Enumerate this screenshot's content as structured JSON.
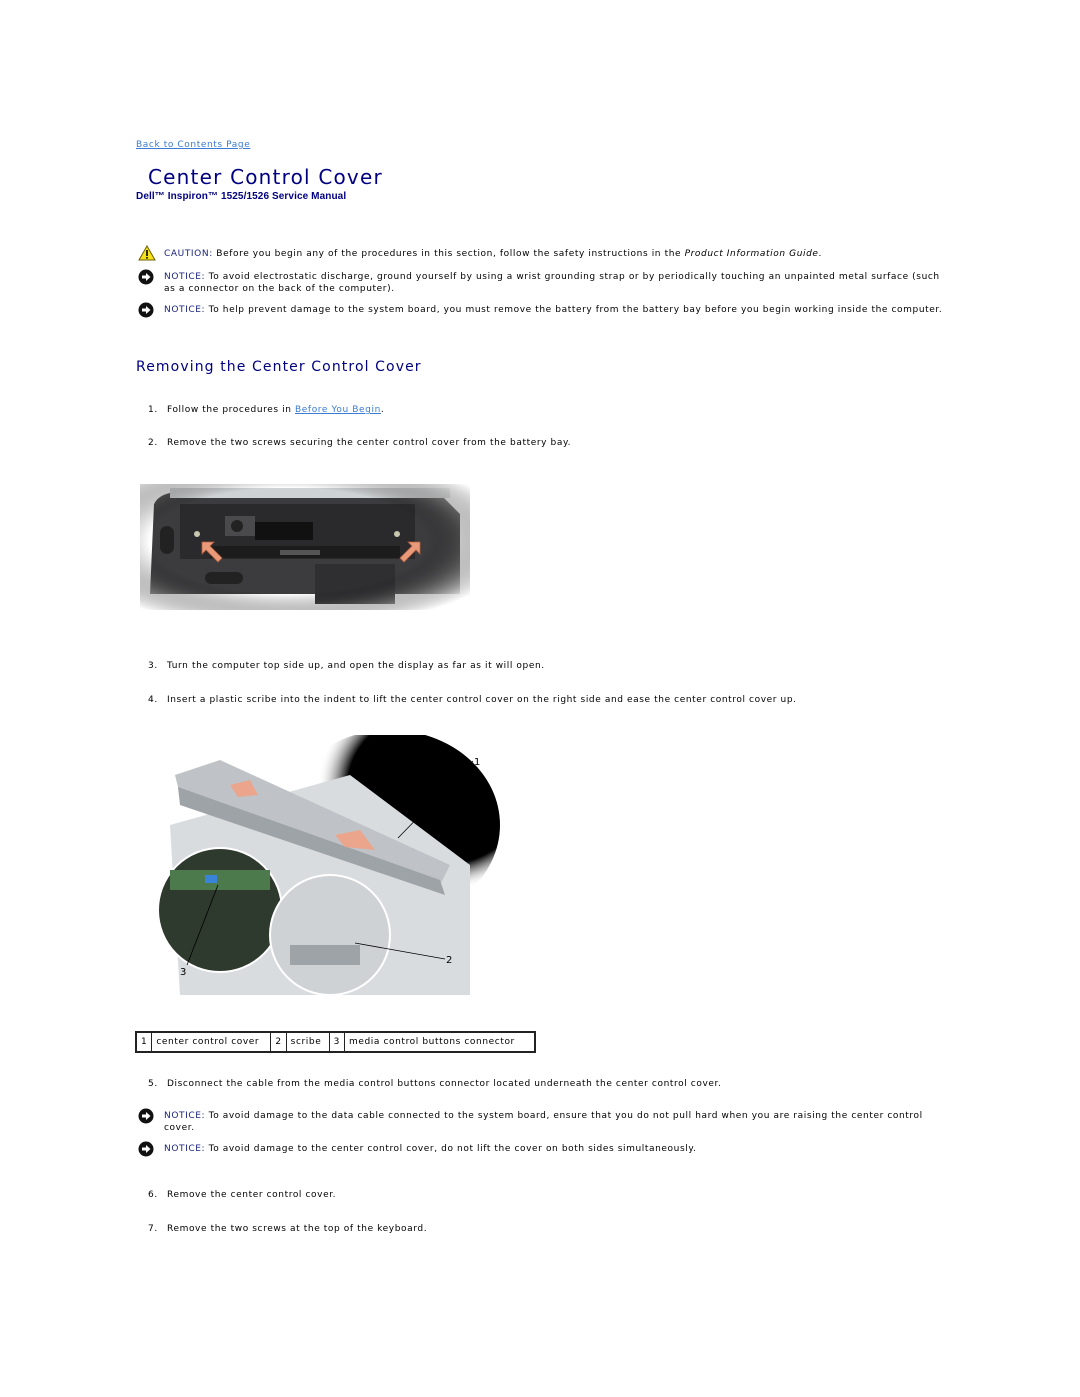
{
  "nav": {
    "back_link": "Back to Contents Page"
  },
  "header": {
    "title": "Center Control Cover",
    "subtitle": "Dell™ Inspiron™ 1525/1526 Service Manual"
  },
  "notices_top": [
    {
      "type": "caution",
      "icon": "warning-triangle-icon",
      "label": "CAUTION:",
      "text": " Before you begin any of the procedures in this section, follow the safety instructions in the ",
      "italic": "Product Information Guide",
      "after": "."
    },
    {
      "type": "notice",
      "icon": "notice-arrow-icon",
      "label": "NOTICE:",
      "text": " To avoid electrostatic discharge, ground yourself by using a wrist grounding strap or by periodically touching an unpainted metal surface (such as a connector on the back of the computer)."
    },
    {
      "type": "notice",
      "icon": "notice-arrow-icon",
      "label": "NOTICE:",
      "text": " To help prevent damage to the system board, you must remove the battery from the battery bay before you begin working inside the computer."
    }
  ],
  "section": {
    "heading": "Removing the Center Control Cover",
    "steps": [
      {
        "num": "1.",
        "text": "Follow the procedures in ",
        "link": "Before You Begin",
        "after": "."
      },
      {
        "num": "2.",
        "text": "Remove the two screws securing the center control cover from the battery bay."
      },
      {
        "num": "3.",
        "text": "Turn the computer top side up, and open the display as far as it will open."
      },
      {
        "num": "4.",
        "text": "Insert a plastic scribe into the indent to lift the center control cover on the right side and ease the center control cover up."
      },
      {
        "num": "5.",
        "text": "Disconnect the cable from the media control buttons connector located underneath the center control cover."
      },
      {
        "num": "6.",
        "text": "Remove the center control cover."
      },
      {
        "num": "7.",
        "text": "Remove the two screws at the top of the keyboard."
      }
    ],
    "figure1": {
      "alt": "battery bay screws illustration"
    },
    "figure2": {
      "alt": "center control cover removal illustration",
      "callouts": [
        "1",
        "2",
        "3"
      ]
    },
    "legend": [
      {
        "num": "1",
        "label": "center control cover"
      },
      {
        "num": "2",
        "label": "scribe"
      },
      {
        "num": "3",
        "label": "media control buttons connector"
      }
    ],
    "notices_mid": [
      {
        "type": "notice",
        "icon": "notice-arrow-icon",
        "label": "NOTICE:",
        "text": " To avoid damage to the data cable connected to the system board, ensure that you do not pull hard when you are raising the center control cover."
      },
      {
        "type": "notice",
        "icon": "notice-arrow-icon",
        "label": "NOTICE:",
        "text": " To avoid damage to the center control cover, do not lift the cover on both sides simultaneously."
      }
    ]
  },
  "colors": {
    "title": "#000080",
    "link": "#3a7bd5",
    "label": "#1a237e"
  }
}
